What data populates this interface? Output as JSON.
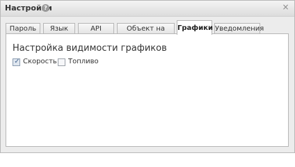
{
  "window": {
    "title": "Настройки",
    "help_icon": "help-icon",
    "close_icon": "close-icon",
    "close_glyph": "×"
  },
  "tabs": [
    {
      "label": "Пароль",
      "active": false
    },
    {
      "label": "Язык",
      "active": false
    },
    {
      "label": "API",
      "active": false
    },
    {
      "label": "Объект на карте",
      "active": false
    },
    {
      "label": "Графики",
      "active": true
    },
    {
      "label": "Уведомления",
      "active": false
    }
  ],
  "content": {
    "section_title": "Настройка видимости графиков",
    "checkboxes": [
      {
        "label": "Скорость",
        "checked": true
      },
      {
        "label": "Топливо",
        "checked": false
      }
    ]
  }
}
